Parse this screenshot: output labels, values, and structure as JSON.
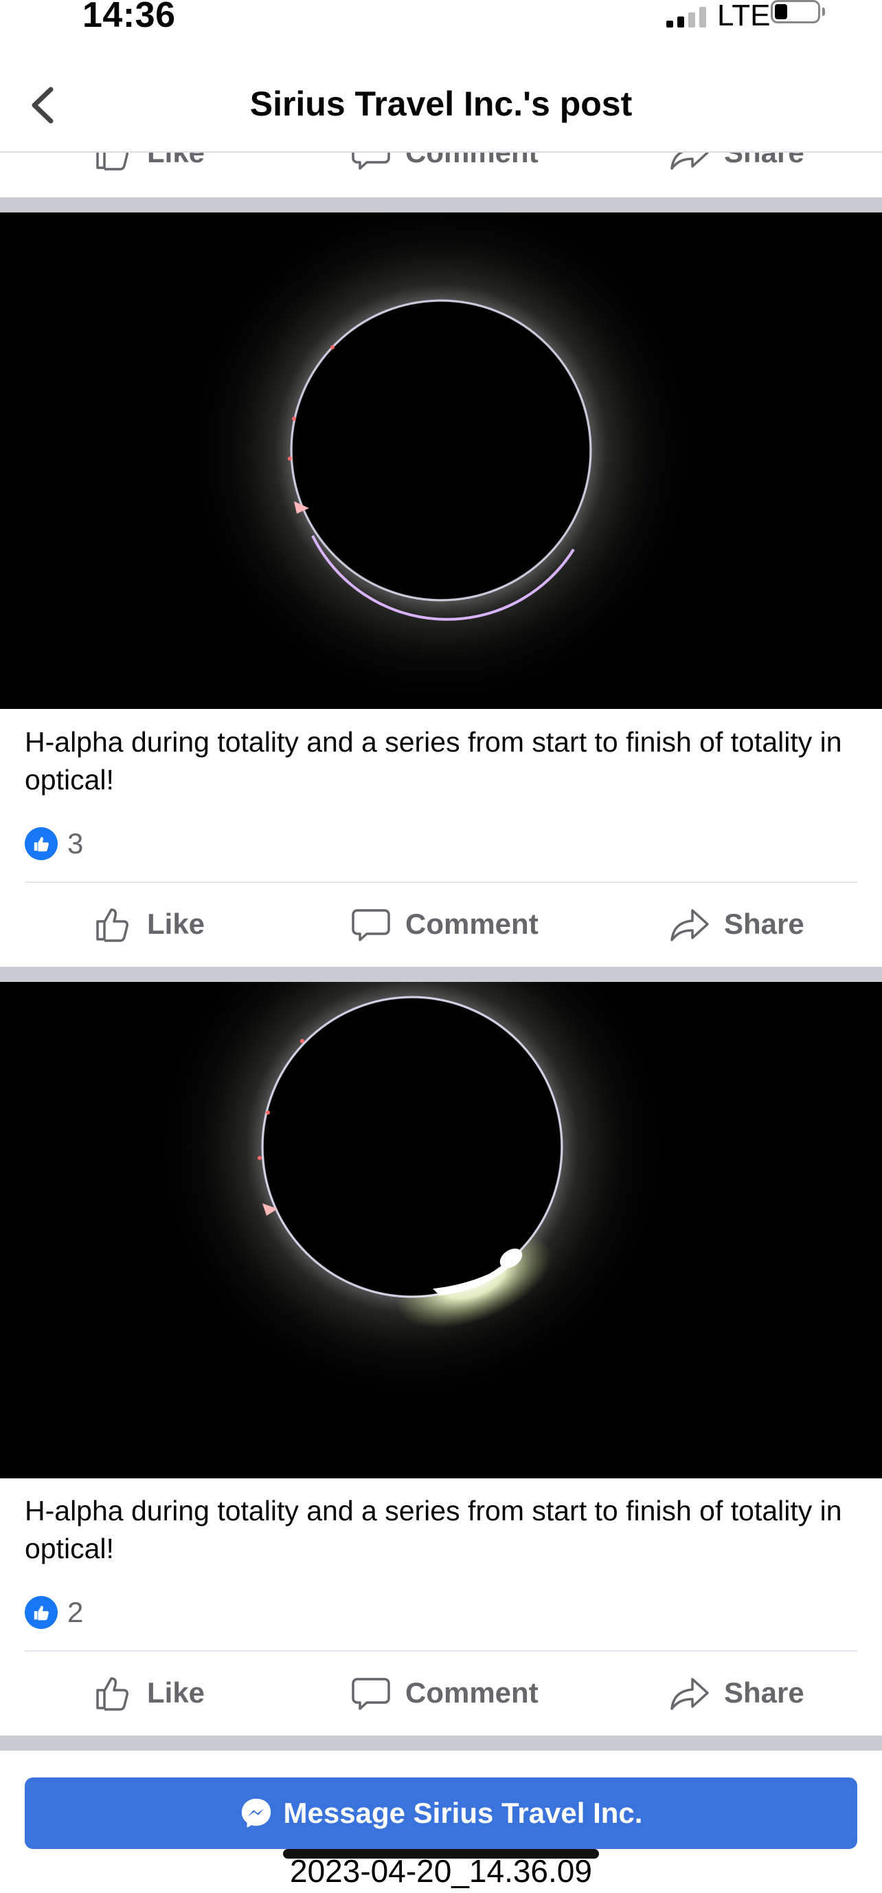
{
  "status_bar": {
    "time": "14:36",
    "network": "LTE"
  },
  "header": {
    "title": "Sirius Travel Inc.'s post"
  },
  "actions": {
    "like": "Like",
    "comment": "Comment",
    "share": "Share"
  },
  "posts": [
    {
      "caption": "H-alpha during totality and a series from start to finish of totality in optical!",
      "reaction_count": "3"
    },
    {
      "caption": "H-alpha during totality and a series from start to finish of totality in optical!",
      "reaction_count": "2"
    }
  ],
  "bottom": {
    "message_button": "Message Sirius Travel Inc.",
    "timestamp": "2023-04-20_14.36.09"
  },
  "colors": {
    "accent": "#3b73dc",
    "like_blue": "#1877f2",
    "muted_text": "#65676b",
    "separator": "#c9ccd1"
  }
}
